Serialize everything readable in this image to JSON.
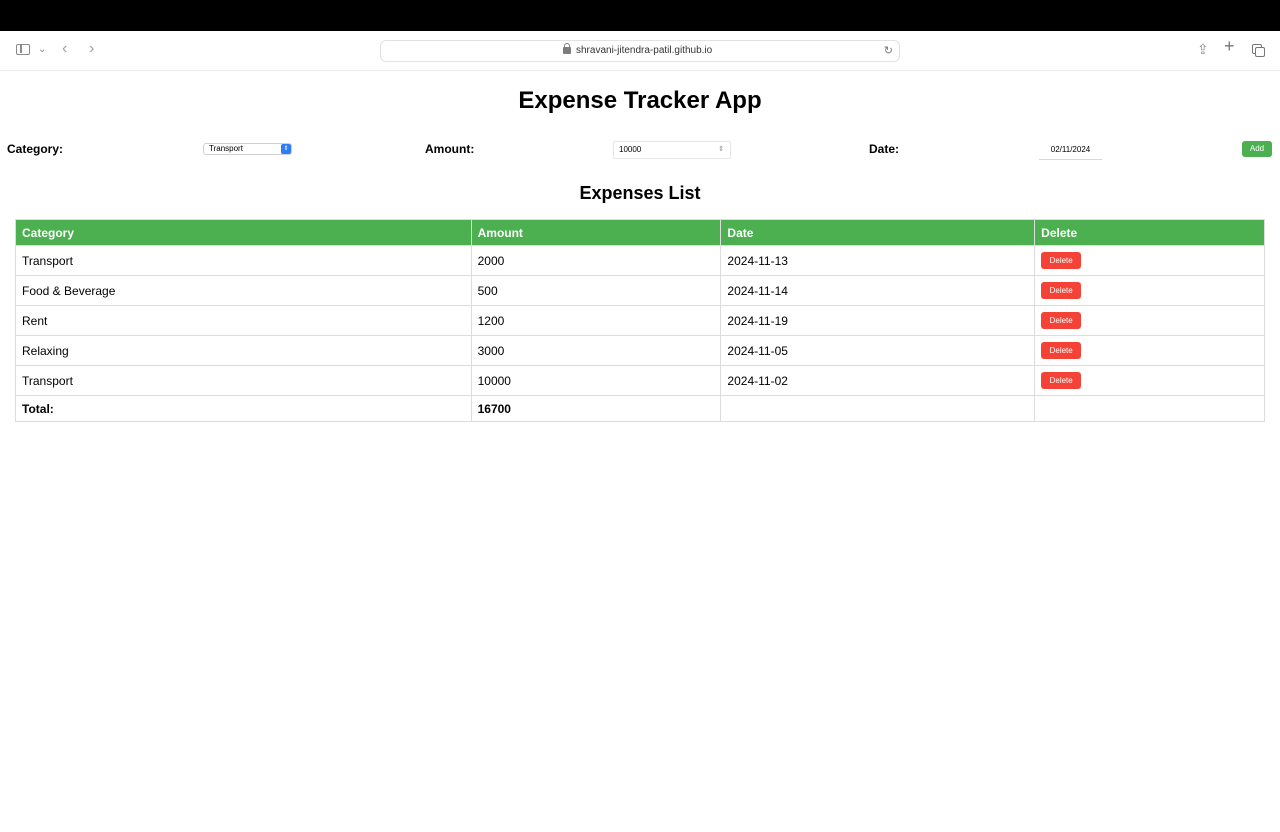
{
  "browser": {
    "url": "shravani-jitendra-patil.github.io"
  },
  "app": {
    "title": "Expense Tracker App"
  },
  "form": {
    "category_label": "Category:",
    "category_value": "Transport",
    "amount_label": "Amount:",
    "amount_value": "10000",
    "date_label": "Date:",
    "date_value": "02/11/2024",
    "add_label": "Add"
  },
  "list": {
    "title": "Expenses List",
    "headers": [
      "Category",
      "Amount",
      "Date",
      "Delete"
    ],
    "rows": [
      {
        "category": "Transport",
        "amount": "2000",
        "date": "2024-11-13",
        "delete_label": "Delete"
      },
      {
        "category": "Food & Beverage",
        "amount": "500",
        "date": "2024-11-14",
        "delete_label": "Delete"
      },
      {
        "category": "Rent",
        "amount": "1200",
        "date": "2024-11-19",
        "delete_label": "Delete"
      },
      {
        "category": "Relaxing",
        "amount": "3000",
        "date": "2024-11-05",
        "delete_label": "Delete"
      },
      {
        "category": "Transport",
        "amount": "10000",
        "date": "2024-11-02",
        "delete_label": "Delete"
      }
    ],
    "total_label": "Total:",
    "total_value": "16700"
  },
  "colors": {
    "accent_green": "#4caf50",
    "delete_red": "#f44336",
    "select_blue": "#2f7cf6"
  },
  "icons": [
    "sidebar-icon",
    "chevron-down-icon",
    "back-icon",
    "forward-icon",
    "lock-icon",
    "reload-icon",
    "share-icon",
    "plus-icon",
    "tabs-icon"
  ]
}
